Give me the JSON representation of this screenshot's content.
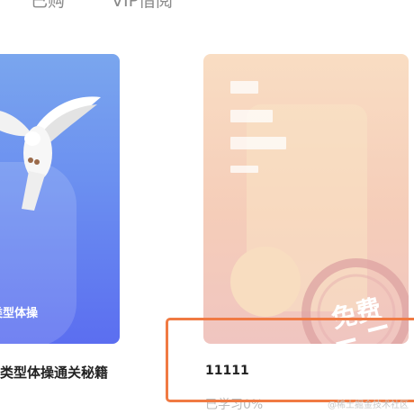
{
  "tabs": [
    {
      "label": "已购"
    },
    {
      "label": "VIP借阅"
    }
  ],
  "books": [
    {
      "cover_text": "类型体操",
      "title": "类型体操通关秘籍",
      "cover_color": "#6b8ff0"
    },
    {
      "title": "11111",
      "progress_label": "已学习0%",
      "badge": "免费",
      "cover_color": "#f5cdb9"
    }
  ],
  "highlight_color": "#f07a43",
  "watermark": "@稀土掘金技术社区",
  "icons": [
    "dove-icon",
    "free-stamp-icon"
  ]
}
